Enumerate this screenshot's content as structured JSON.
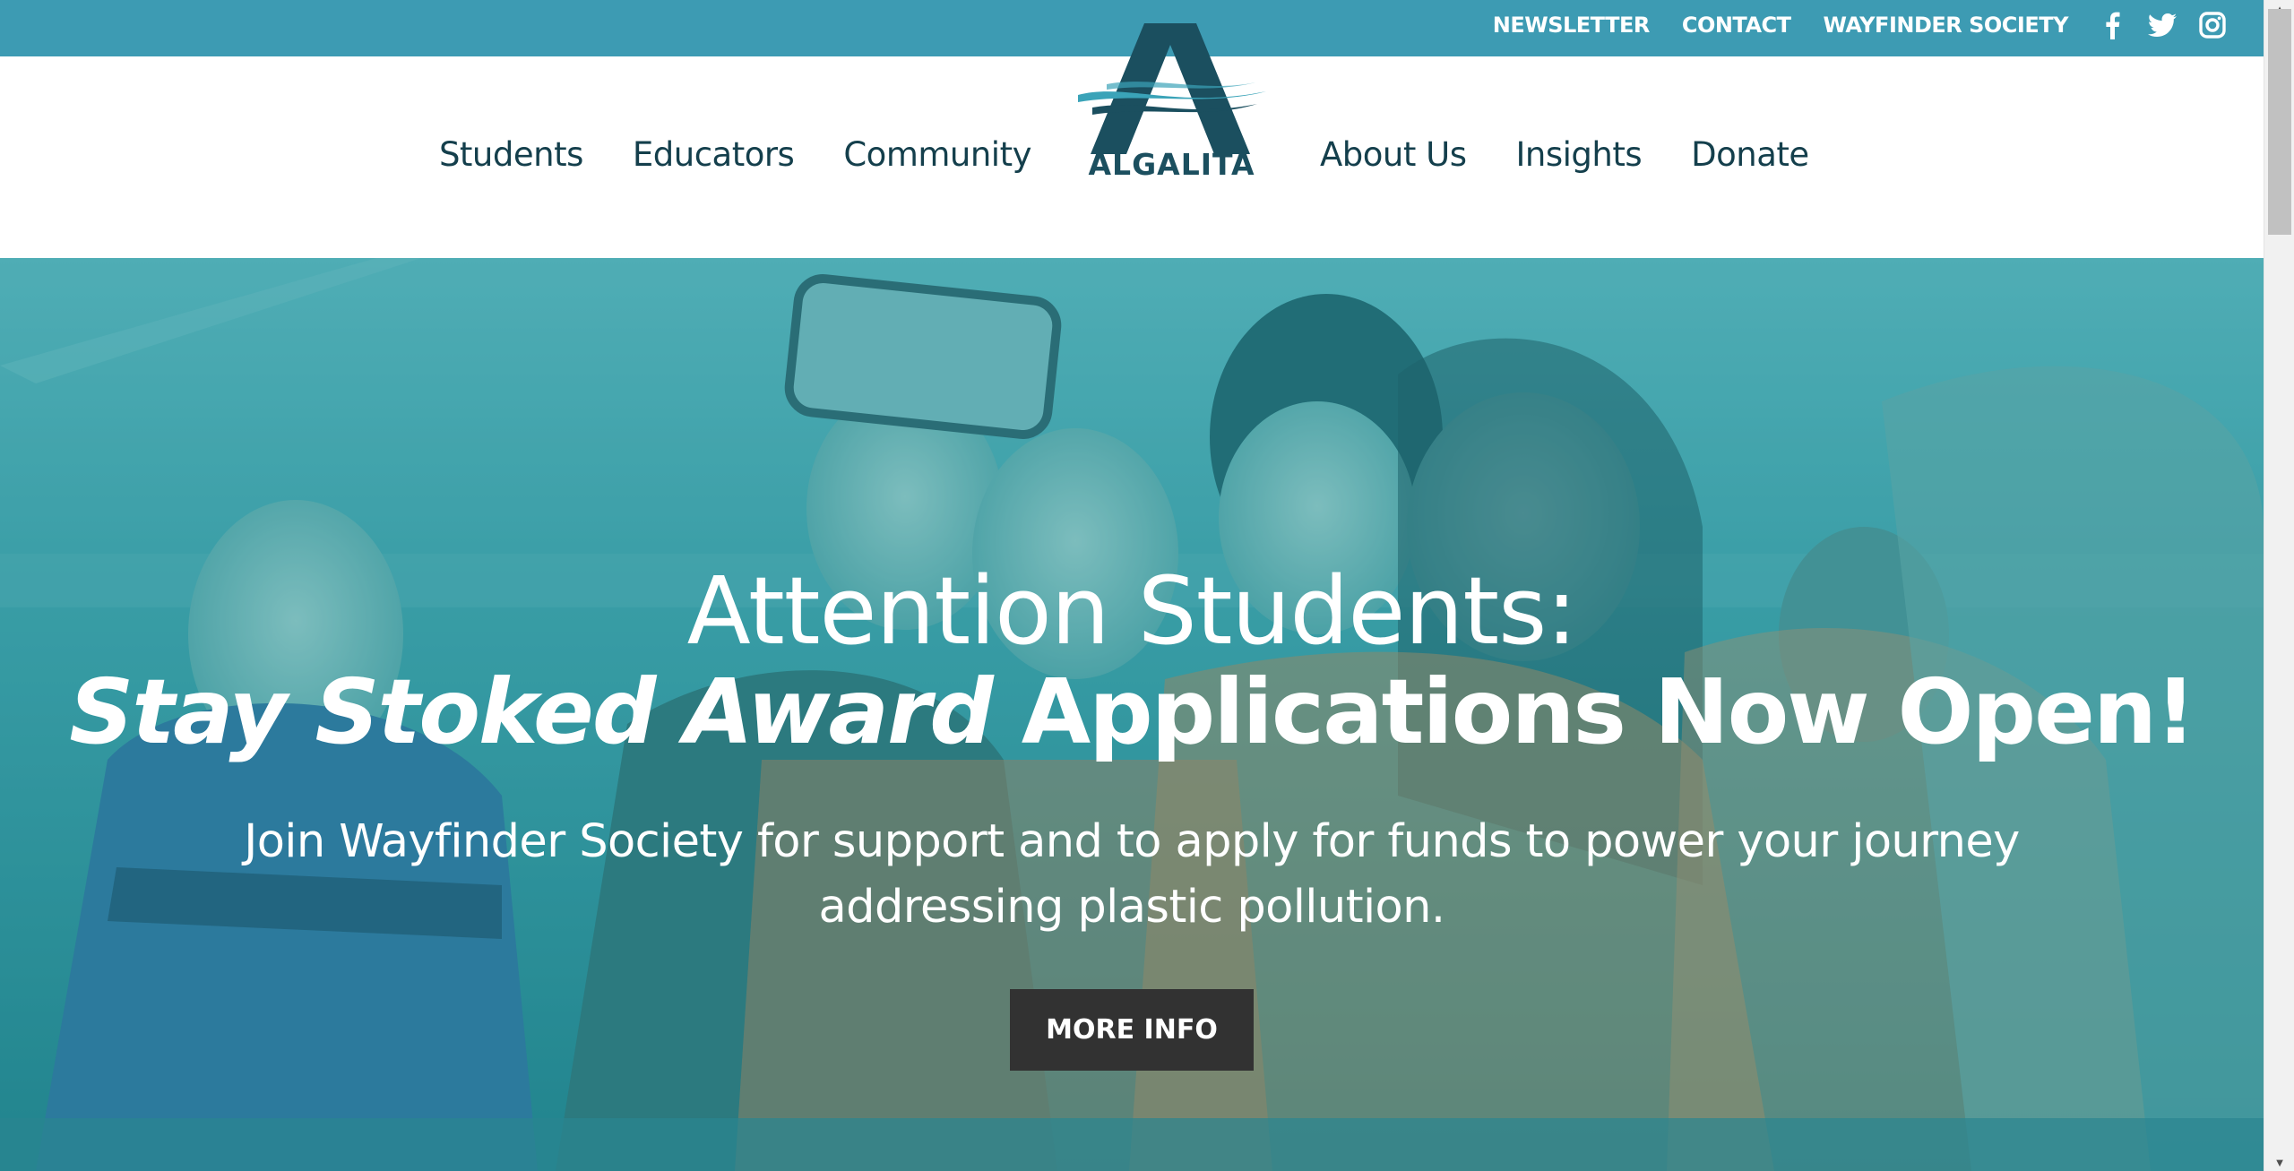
{
  "topbar": {
    "links": [
      "NEWSLETTER",
      "CONTACT",
      "WAYFINDER SOCIETY"
    ],
    "social_icons": [
      "facebook-icon",
      "twitter-icon",
      "instagram-icon"
    ],
    "background": "#3d9bb3"
  },
  "nav": {
    "left_items": [
      "Students",
      "Educators",
      "Community"
    ],
    "right_items": [
      "About Us",
      "Insights",
      "Donate"
    ],
    "text_color": "#143f4c"
  },
  "logo": {
    "text": "ALGALITA",
    "color": "#1b4f5f",
    "accent": "#3aa3b8"
  },
  "hero": {
    "line1": "Attention Students:",
    "line2_emphasis": "Stay Stoked Award",
    "line2_rest": "Applications Now Open!",
    "subtitle": "Join Wayfinder Society for support and to apply for funds to power your journey addressing plastic pollution.",
    "button_label": "MORE INFO",
    "button_color": "#323232",
    "overlay_color": "#2b8d97"
  }
}
